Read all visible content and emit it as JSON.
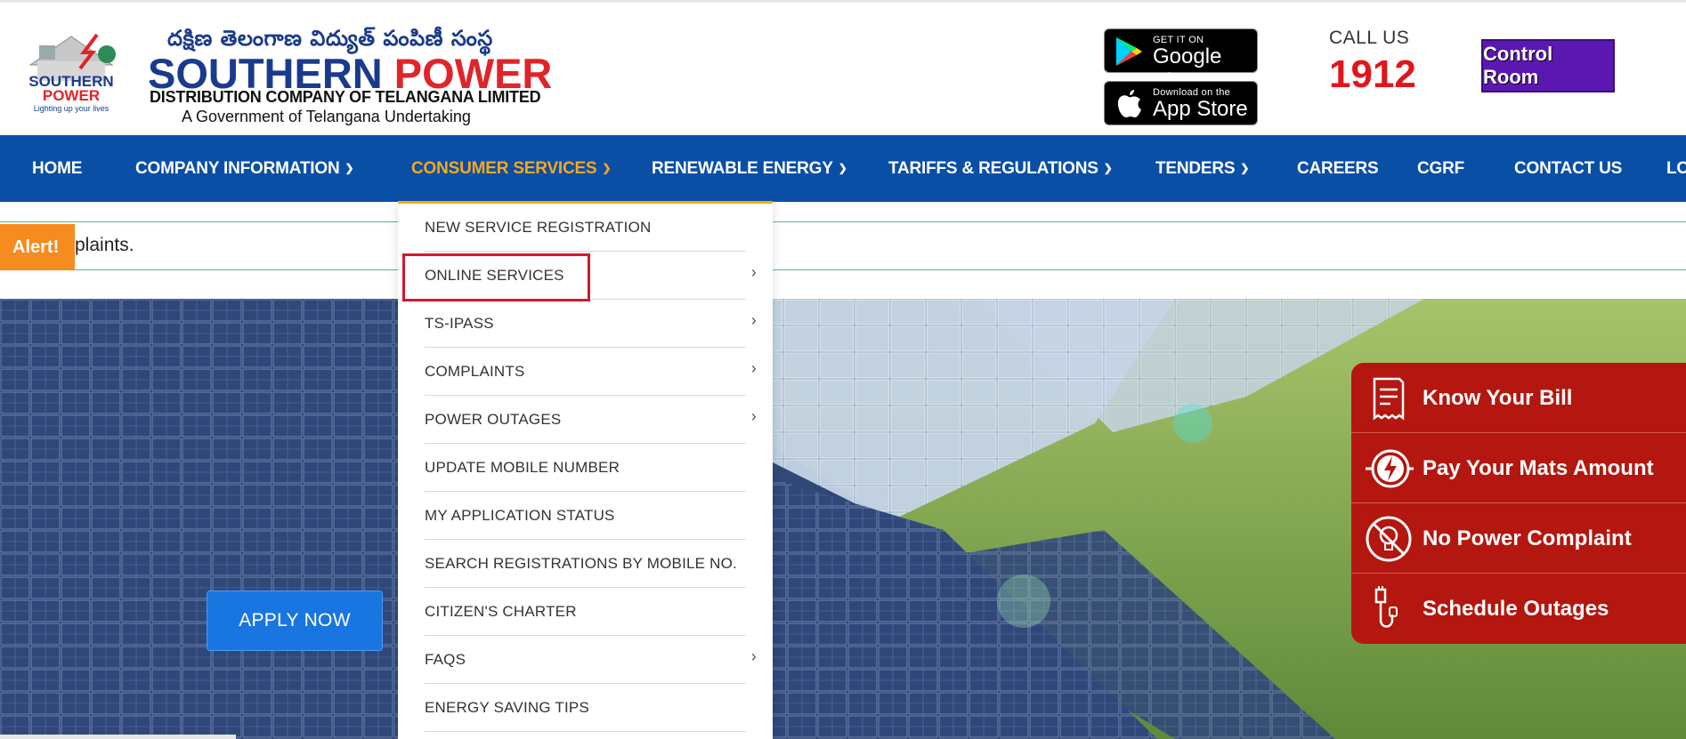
{
  "header": {
    "logo_telugu": "దక్షిణ తెలంగాణ విద్యుత్ పంపిణీ సంస్థ",
    "logo_name_part1": "SOUTHERN",
    "logo_name_part2": "POWER",
    "logo_subtitle": "DISTRIBUTION COMPANY OF TELANGANA LIMITED",
    "logo_gov": "A Government of Telangana Undertaking",
    "emblem_text_1": "SOUTHERN",
    "emblem_text_2": "POWER",
    "emblem_tagline": "Lighting up your lives",
    "google_play_small": "GET IT ON",
    "google_play_big": "Google Play",
    "app_store_small": "Download on the",
    "app_store_big": "App Store",
    "call_label": "CALL US",
    "call_number": "1912",
    "control_room": "Control Room"
  },
  "nav": {
    "items": [
      {
        "label": "HOME"
      },
      {
        "label": "COMPANY INFORMATION"
      },
      {
        "label": "CONSUMER SERVICES"
      },
      {
        "label": "RENEWABLE ENERGY"
      },
      {
        "label": "TARIFFS & REGULATIONS"
      },
      {
        "label": "TENDERS"
      },
      {
        "label": "CAREERS"
      },
      {
        "label": "CGRF"
      },
      {
        "label": "CONTACT US"
      },
      {
        "label": "LO"
      }
    ]
  },
  "alert": {
    "tag": "Alert!",
    "text": "plaints."
  },
  "dropdown": {
    "items": [
      {
        "label": "NEW SERVICE REGISTRATION"
      },
      {
        "label": "ONLINE SERVICES"
      },
      {
        "label": "TS-IPASS"
      },
      {
        "label": "COMPLAINTS"
      },
      {
        "label": "POWER OUTAGES"
      },
      {
        "label": "UPDATE MOBILE NUMBER"
      },
      {
        "label": "MY APPLICATION STATUS"
      },
      {
        "label": "SEARCH REGISTRATIONS BY MOBILE NO."
      },
      {
        "label": "CITIZEN'S CHARTER"
      },
      {
        "label": "FAQS"
      },
      {
        "label": "ENERGY SAVING TIPS"
      }
    ]
  },
  "hero": {
    "apply_button": "APPLY NOW"
  },
  "quick_links": [
    {
      "label": "Know Your Bill",
      "icon": "bill-icon"
    },
    {
      "label": "Pay Your Mats Amount",
      "icon": "plug-bolt-icon"
    },
    {
      "label": "No Power Complaint",
      "icon": "no-bulb-icon"
    },
    {
      "label": "Schedule Outages",
      "icon": "cable-icon"
    }
  ],
  "colors": {
    "nav_bg": "#0a4fa6",
    "nav_active": "#f6a81c",
    "call_number": "#e1151c",
    "control_room_bg": "#5b18b0",
    "quick_links_bg": "#b3170f",
    "alert_tag_bg": "#f68b1f",
    "apply_button_bg": "#1976e0"
  }
}
